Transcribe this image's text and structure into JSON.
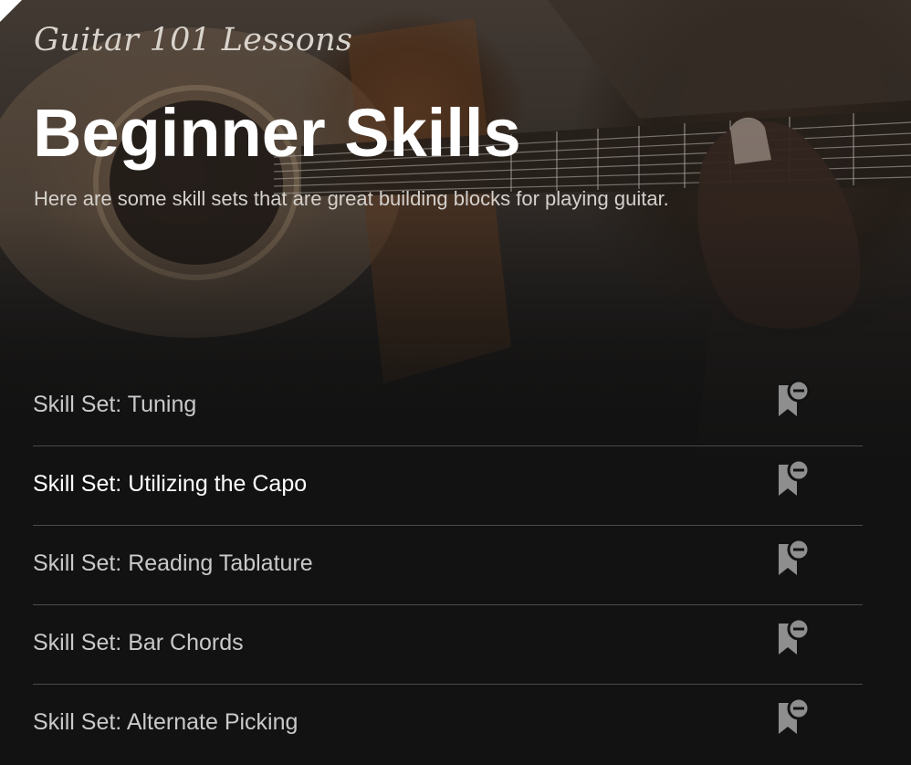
{
  "header": {
    "eyebrow": "Guitar 101 Lessons",
    "title": "Beginner Skills",
    "subtitle": "Here are some skill sets that are great building blocks for playing guitar."
  },
  "skills": [
    {
      "label": "Skill Set: Tuning",
      "icon": "bookmark-remove-icon",
      "active": false
    },
    {
      "label": "Skill Set: Utilizing the Capo",
      "icon": "bookmark-remove-icon",
      "active": true
    },
    {
      "label": "Skill Set: Reading Tablature",
      "icon": "bookmark-remove-icon",
      "active": false
    },
    {
      "label": "Skill Set: Bar Chords",
      "icon": "bookmark-remove-icon",
      "active": false
    },
    {
      "label": "Skill Set: Alternate Picking",
      "icon": "bookmark-remove-icon",
      "active": false
    }
  ],
  "colors": {
    "background": "#121212",
    "title": "#ffffff",
    "item_text": "#c9c9c9",
    "item_text_active": "#ffffff",
    "divider": "#4a4a4a",
    "icon": "#8e8e8e"
  }
}
